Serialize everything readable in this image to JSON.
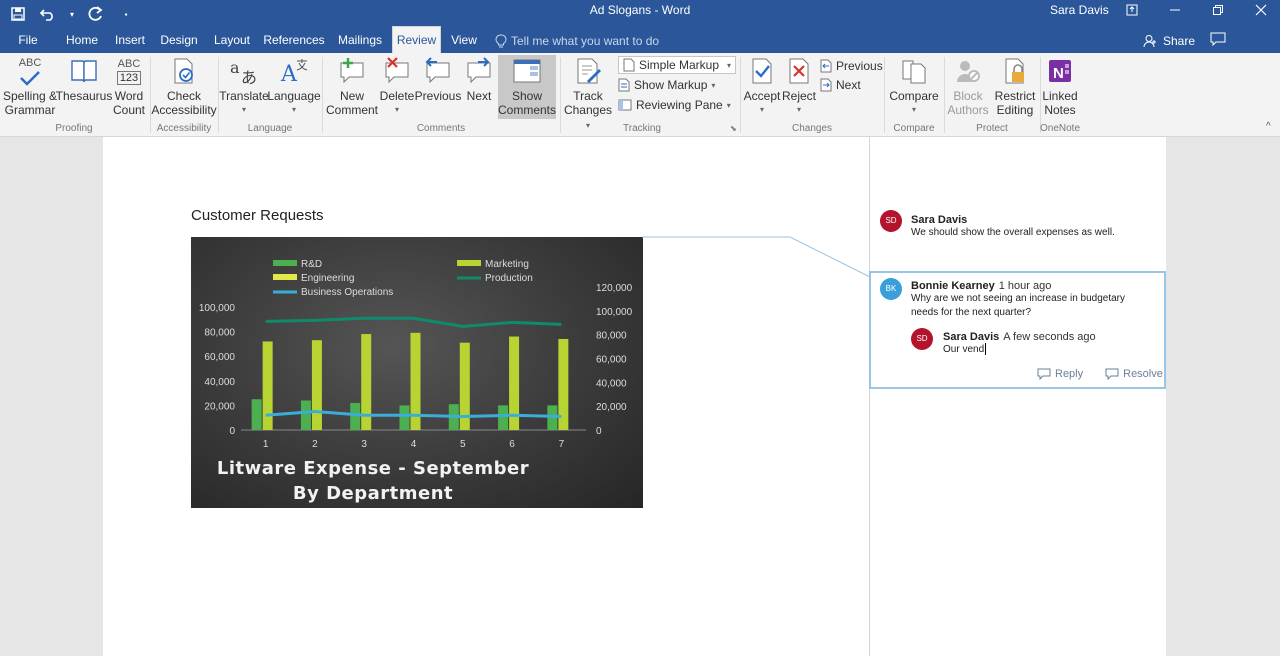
{
  "title_bar": {
    "doc_title": "Ad Slogans - Word",
    "user": "Sara Davis"
  },
  "tabs": [
    {
      "label": "File"
    },
    {
      "label": "Home"
    },
    {
      "label": "Insert"
    },
    {
      "label": "Design"
    },
    {
      "label": "Layout"
    },
    {
      "label": "References"
    },
    {
      "label": "Mailings"
    },
    {
      "label": "Review"
    },
    {
      "label": "View"
    }
  ],
  "tell_me": "Tell me what you want to do",
  "share": "Share",
  "ribbon": {
    "spelling": {
      "line1": "Spelling &",
      "line2": "Grammar"
    },
    "thesaurus": "Thesaurus",
    "word_count": {
      "line1": "Word",
      "line2": "Count"
    },
    "check_access": {
      "line1": "Check",
      "line2": "Accessibility"
    },
    "translate": "Translate",
    "language": "Language",
    "new_comment": {
      "line1": "New",
      "line2": "Comment"
    },
    "delete": "Delete",
    "previous": "Previous",
    "next": "Next",
    "show_comments": {
      "line1": "Show",
      "line2": "Comments"
    },
    "track_changes": {
      "line1": "Track",
      "line2": "Changes"
    },
    "simple_markup": "Simple Markup",
    "show_markup": "Show Markup",
    "reviewing_pane": "Reviewing Pane",
    "accept": "Accept",
    "reject": "Reject",
    "changes_previous": "Previous",
    "changes_next": "Next",
    "compare": "Compare",
    "block_authors": {
      "line1": "Block",
      "line2": "Authors"
    },
    "restrict_editing": {
      "line1": "Restrict",
      "line2": "Editing"
    },
    "linked_notes": {
      "line1": "Linked",
      "line2": "Notes"
    },
    "abc_top": "ABC",
    "abc_123": "123",
    "groups": {
      "proofing": "Proofing",
      "accessibility": "Accessibility",
      "language": "Language",
      "comments": "Comments",
      "tracking": "Tracking",
      "changes": "Changes",
      "compare": "Compare",
      "protect": "Protect",
      "onenote": "OneNote"
    }
  },
  "document": {
    "heading": "Customer Requests"
  },
  "chart_data": {
    "type": "bar",
    "title": "Litware Expense - September",
    "subtitle": "By Department",
    "categories": [
      "1",
      "2",
      "3",
      "4",
      "5",
      "6",
      "7"
    ],
    "ylim": [
      0,
      100000
    ],
    "y2lim": [
      0,
      120000
    ],
    "yticks": [
      "100,000",
      "80,000",
      "60,000",
      "40,000",
      "20,000",
      "0"
    ],
    "y2ticks": [
      "120,000",
      "100,000",
      "80,000",
      "60,000",
      "40,000",
      "20,000",
      "0"
    ],
    "legend": [
      "R&D",
      "Marketing",
      "Engineering",
      "Production",
      "Business Operations"
    ],
    "series": [
      {
        "name": "R&D",
        "kind": "bar",
        "color": "#4caf50",
        "values": [
          25000,
          24000,
          22000,
          20000,
          21000,
          20000,
          20000
        ]
      },
      {
        "name": "Marketing",
        "kind": "bar",
        "color": "#b8d432",
        "values": [
          72000,
          73000,
          78000,
          79000,
          71000,
          76000,
          74000
        ]
      },
      {
        "name": "Engineering",
        "kind": "bar",
        "color": "#e2e84a",
        "values": [
          0,
          0,
          0,
          0,
          0,
          0,
          0
        ]
      },
      {
        "name": "Production",
        "kind": "line",
        "axis": "right",
        "color": "#0f8a6a",
        "values": [
          106000,
          107000,
          109000,
          109000,
          101000,
          105000,
          103000
        ]
      },
      {
        "name": "Business Operations",
        "kind": "line",
        "axis": "left",
        "color": "#3aaed8",
        "values": [
          12000,
          15000,
          12000,
          12000,
          11000,
          12000,
          11000
        ]
      }
    ]
  },
  "comments": [
    {
      "initials": "SD",
      "author": "Sara Davis",
      "time": "",
      "text": "We should show the overall expenses as well."
    },
    {
      "initials": "BK",
      "author": "Bonnie Kearney",
      "time": "1 hour ago",
      "text_line1": "Why are we not seeing an increase in budgetary",
      "text_line2": "needs for the next quarter?"
    },
    {
      "initials": "SD",
      "author": "Sara Davis",
      "time": "A few seconds ago",
      "text": "Our vend"
    }
  ],
  "comment_actions": {
    "reply": "Reply",
    "resolve": "Resolve"
  },
  "colors": {
    "accent": "#2b579a",
    "avatar_sd": "#b3132b",
    "avatar_bk": "#3a9fd8"
  }
}
